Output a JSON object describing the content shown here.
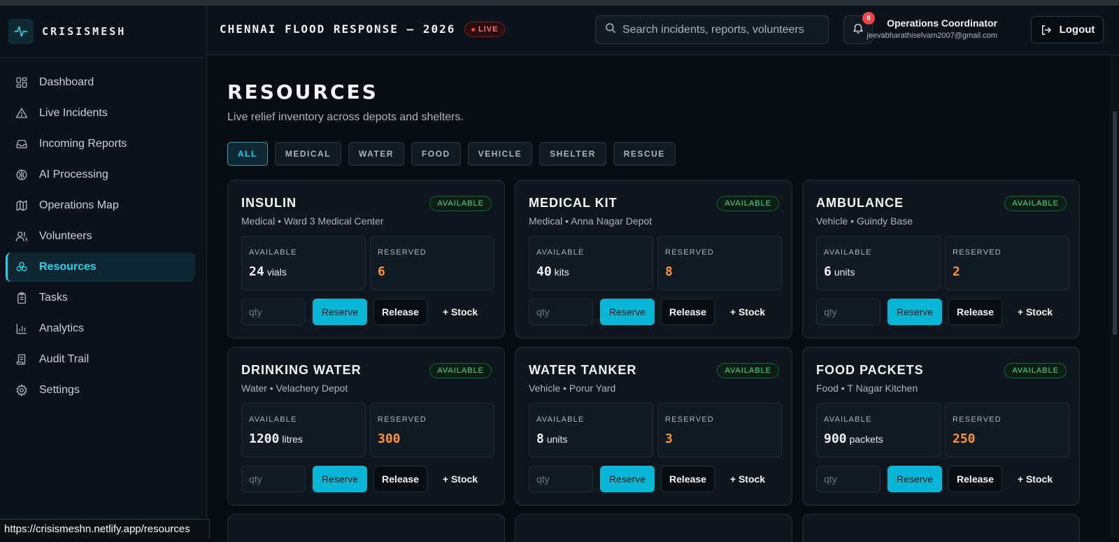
{
  "app": {
    "brand": "CRISISMESH"
  },
  "sidebar": {
    "items": [
      {
        "label": "Dashboard",
        "icon": "grid-icon"
      },
      {
        "label": "Live Incidents",
        "icon": "alert-triangle-icon"
      },
      {
        "label": "Incoming Reports",
        "icon": "inbox-icon"
      },
      {
        "label": "AI Processing",
        "icon": "brain-icon"
      },
      {
        "label": "Operations Map",
        "icon": "map-icon"
      },
      {
        "label": "Volunteers",
        "icon": "users-icon"
      },
      {
        "label": "Resources",
        "icon": "boxes-icon",
        "active": true
      },
      {
        "label": "Tasks",
        "icon": "clipboard-icon"
      },
      {
        "label": "Analytics",
        "icon": "bar-chart-icon"
      },
      {
        "label": "Audit Trail",
        "icon": "scroll-icon"
      },
      {
        "label": "Settings",
        "icon": "gear-icon"
      }
    ]
  },
  "header": {
    "event_title": "CHENNAI FLOOD RESPONSE — 2026",
    "live_label": "LIVE",
    "search_placeholder": "Search incidents, reports, volunteers",
    "notification_count": "6",
    "user_role": "Operations Coordinator",
    "user_email": "jeevabharathiselvam2007@gmail.com",
    "logout_label": "Logout"
  },
  "main": {
    "title": "RESOURCES",
    "subtitle": "Live relief inventory across depots and shelters.",
    "filters": [
      "ALL",
      "MEDICAL",
      "WATER",
      "FOOD",
      "VEHICLE",
      "SHELTER",
      "RESCUE"
    ],
    "active_filter": "ALL",
    "labels": {
      "available": "AVAILABLE",
      "reserved": "RESERVED",
      "qty_placeholder": "qty",
      "reserve": "Reserve",
      "release": "Release",
      "stock": "+ Stock"
    },
    "cards": [
      {
        "name": "INSULIN",
        "sub": "Medical • Ward 3 Medical Center",
        "status": "AVAILABLE",
        "available": "24",
        "unit": "vials",
        "reserved": "6"
      },
      {
        "name": "MEDICAL KIT",
        "sub": "Medical • Anna Nagar Depot",
        "status": "AVAILABLE",
        "available": "40",
        "unit": "kits",
        "reserved": "8"
      },
      {
        "name": "AMBULANCE",
        "sub": "Vehicle • Guindy Base",
        "status": "AVAILABLE",
        "available": "6",
        "unit": "units",
        "reserved": "2"
      },
      {
        "name": "DRINKING WATER",
        "sub": "Water • Velachery Depot",
        "status": "AVAILABLE",
        "available": "1200",
        "unit": "litres",
        "reserved": "300"
      },
      {
        "name": "WATER TANKER",
        "sub": "Vehicle • Porur Yard",
        "status": "AVAILABLE",
        "available": "8",
        "unit": "units",
        "reserved": "3"
      },
      {
        "name": "FOOD PACKETS",
        "sub": "Food • T Nagar Kitchen",
        "status": "AVAILABLE",
        "available": "900",
        "unit": "packets",
        "reserved": "250"
      }
    ]
  },
  "statusbar": {
    "url": "https://crisismeshn.netlify.app/resources"
  },
  "colors": {
    "accent": "#22d3ee",
    "reserve_button": "#06b6d4",
    "reserved_value": "#fb923c",
    "available_status": "#4ade80",
    "live": "#ef4444"
  }
}
